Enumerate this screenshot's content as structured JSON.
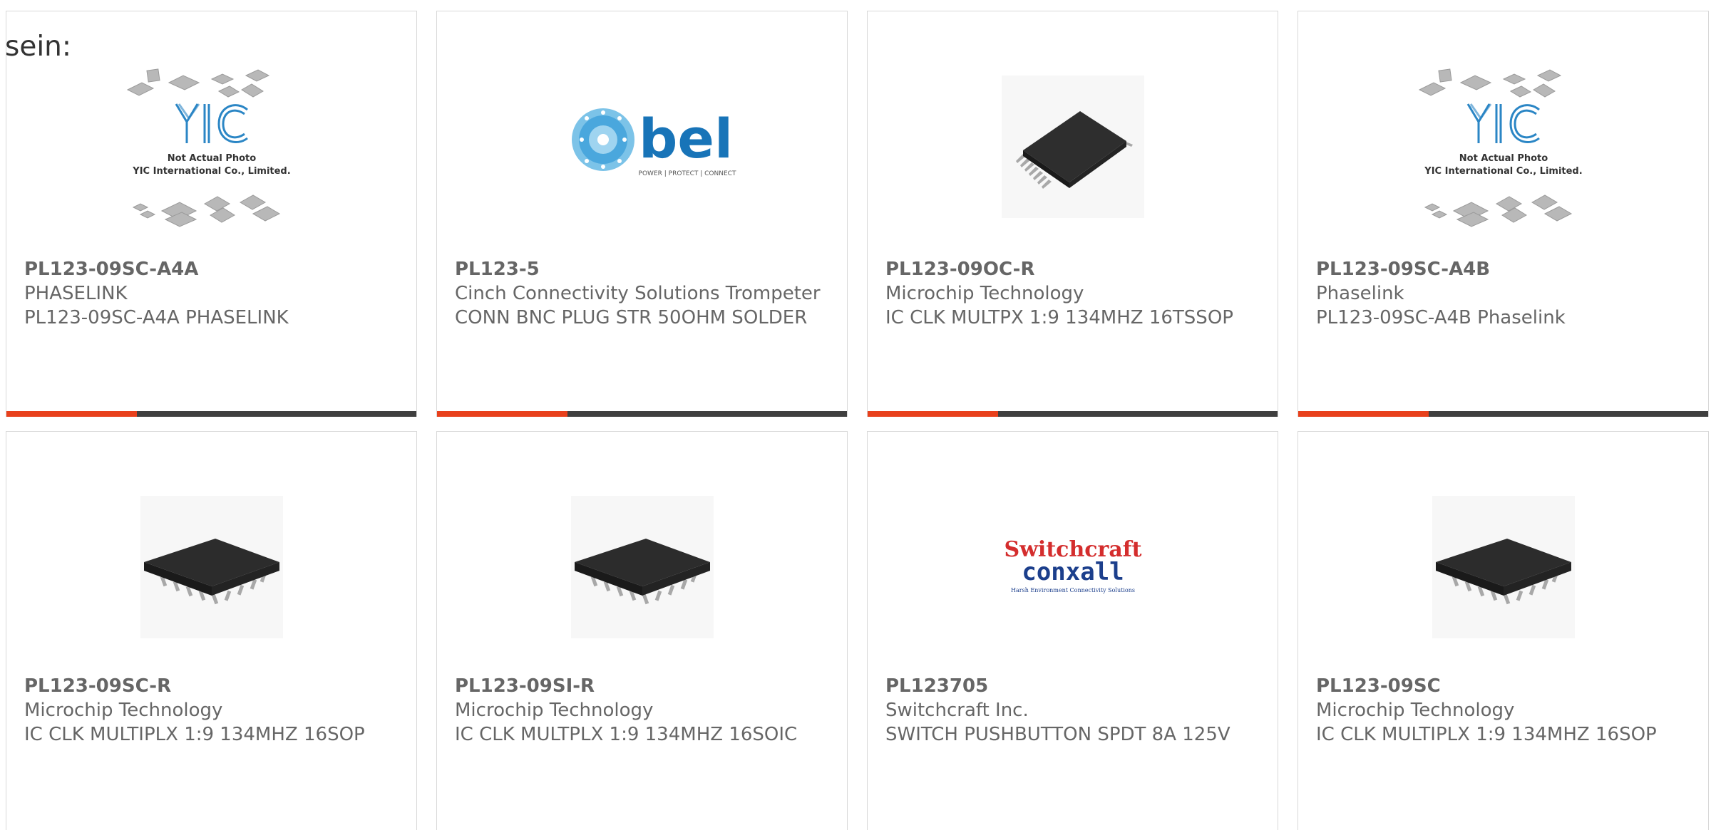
{
  "intro_text": "sein:",
  "colors": {
    "accent": "#e8401c",
    "bar": "#3f3f3f",
    "border": "#d8d8d8",
    "text": "#666666"
  },
  "products": [
    {
      "part_number": "PL123-09SC-A4A",
      "manufacturer": "PHASELINK",
      "description": "PL123-09SC-A4A PHASELINK",
      "image": "yic-placeholder",
      "image_caption_1": "Not Actual Photo",
      "image_caption_2": "YIC International Co., Limited.",
      "image_logo": "YIC"
    },
    {
      "part_number": "PL123-5",
      "manufacturer": "Cinch Connectivity Solutions Trompeter",
      "description": "CONN BNC PLUG STR 50OHM SOLDER",
      "image": "bel-logo",
      "image_logo": "bel",
      "image_tagline": "POWER | PROTECT | CONNECT"
    },
    {
      "part_number": "PL123-09OC-R",
      "manufacturer": "Microchip Technology",
      "description": "IC CLK MULTPX 1:9 134MHZ 16TSSOP",
      "image": "tssop-chip"
    },
    {
      "part_number": "PL123-09SC-A4B",
      "manufacturer": "Phaselink",
      "description": "PL123-09SC-A4B Phaselink",
      "image": "yic-placeholder",
      "image_caption_1": "Not Actual Photo",
      "image_caption_2": "YIC International Co., Limited.",
      "image_logo": "YIC"
    },
    {
      "part_number": "PL123-09SC-R",
      "manufacturer": "Microchip Technology",
      "description": "IC CLK MULTIPLX 1:9 134MHZ 16SOP",
      "image": "soic-chip"
    },
    {
      "part_number": "PL123-09SI-R",
      "manufacturer": "Microchip Technology",
      "description": "IC CLK MULTPLX 1:9 134MHZ 16SOIC",
      "image": "soic-chip"
    },
    {
      "part_number": "PL123705",
      "manufacturer": "Switchcraft Inc.",
      "description": "SWITCH PUSHBUTTON SPDT 8A 125V",
      "image": "switchcraft-logo",
      "image_logo_1": "Switchcraft",
      "image_logo_2": "conxall",
      "image_tagline": "Harsh Environment Connectivity Solutions"
    },
    {
      "part_number": "PL123-09SC",
      "manufacturer": "Microchip Technology",
      "description": "IC CLK MULTIPLX 1:9 134MHZ 16SOP",
      "image": "soic-chip"
    }
  ]
}
